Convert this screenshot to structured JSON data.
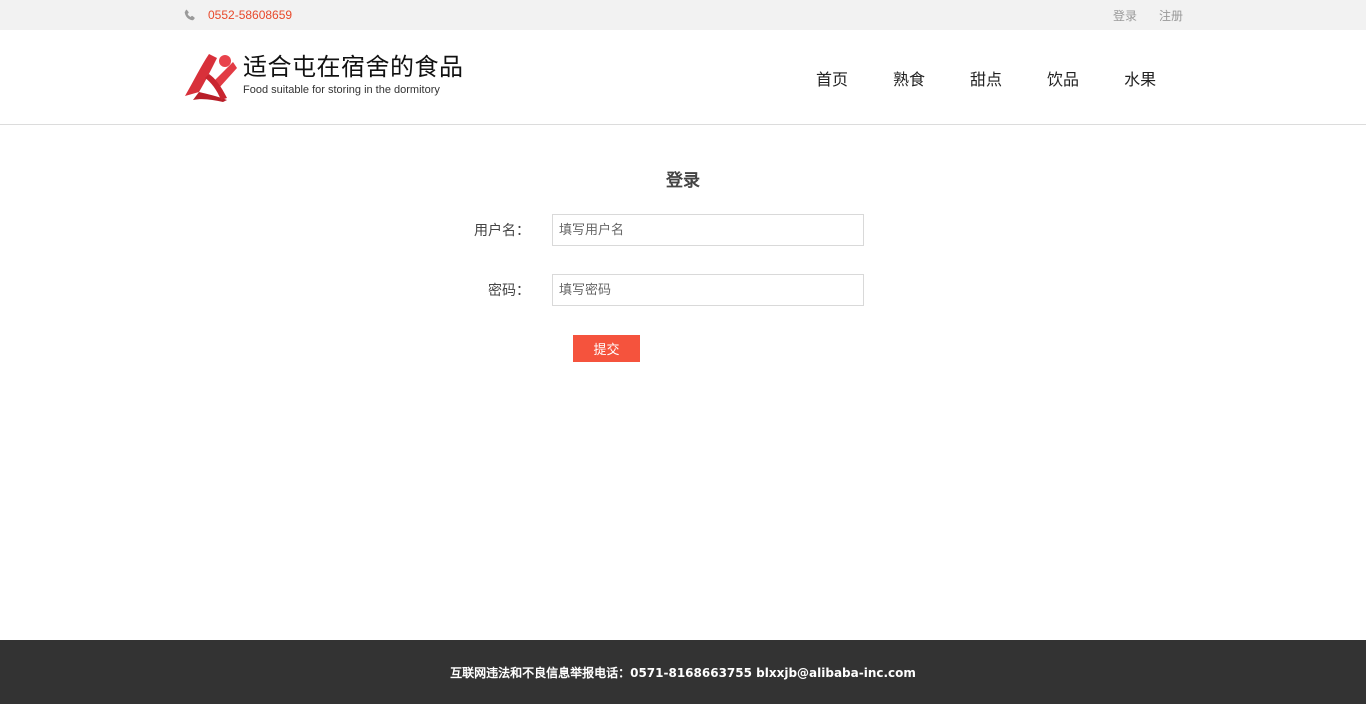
{
  "topbar": {
    "phone_icon": "phone-icon",
    "phone_number": "0552-58608659",
    "login_link": "登录",
    "register_link": "注册"
  },
  "header": {
    "logo_icon": "brand-logo-icon",
    "site_title": "适合屯在宿舍的食品",
    "site_subtitle": "Food suitable for storing in the dormitory",
    "nav": [
      {
        "label": "首页"
      },
      {
        "label": "熟食"
      },
      {
        "label": "甜点"
      },
      {
        "label": "饮品"
      },
      {
        "label": "水果"
      }
    ]
  },
  "login": {
    "title": "登录",
    "username_label": "用户名：",
    "username_placeholder": "填写用户名",
    "username_value": "",
    "password_label": "密码：",
    "password_placeholder": "填写密码",
    "password_value": "",
    "submit_label": "提交"
  },
  "footer": {
    "text": "互联网违法和不良信息举报电话：0571-8168663755 blxxjb@alibaba-inc.com"
  },
  "colors": {
    "accent": "#f5533d",
    "phone_text": "#e8492b",
    "topbar_bg": "#f2f2f2",
    "footer_bg": "#333333"
  }
}
